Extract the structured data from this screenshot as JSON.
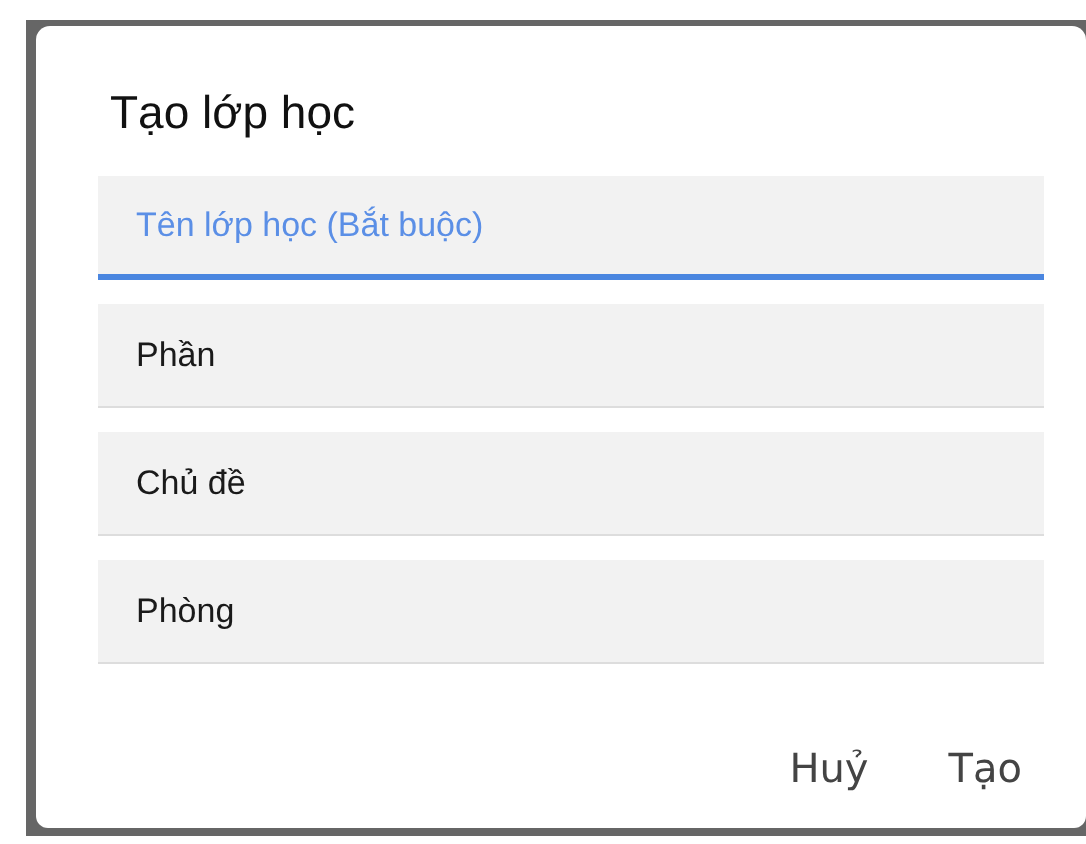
{
  "dialog": {
    "title": "Tạo lớp học",
    "fields": [
      {
        "placeholder": "Tên lớp học (Bắt buộc)",
        "focused": true
      },
      {
        "placeholder": "Phần",
        "focused": false
      },
      {
        "placeholder": "Chủ đề",
        "focused": false
      },
      {
        "placeholder": "Phòng",
        "focused": false
      }
    ],
    "buttons": [
      "Huỷ",
      "Tạo"
    ]
  }
}
